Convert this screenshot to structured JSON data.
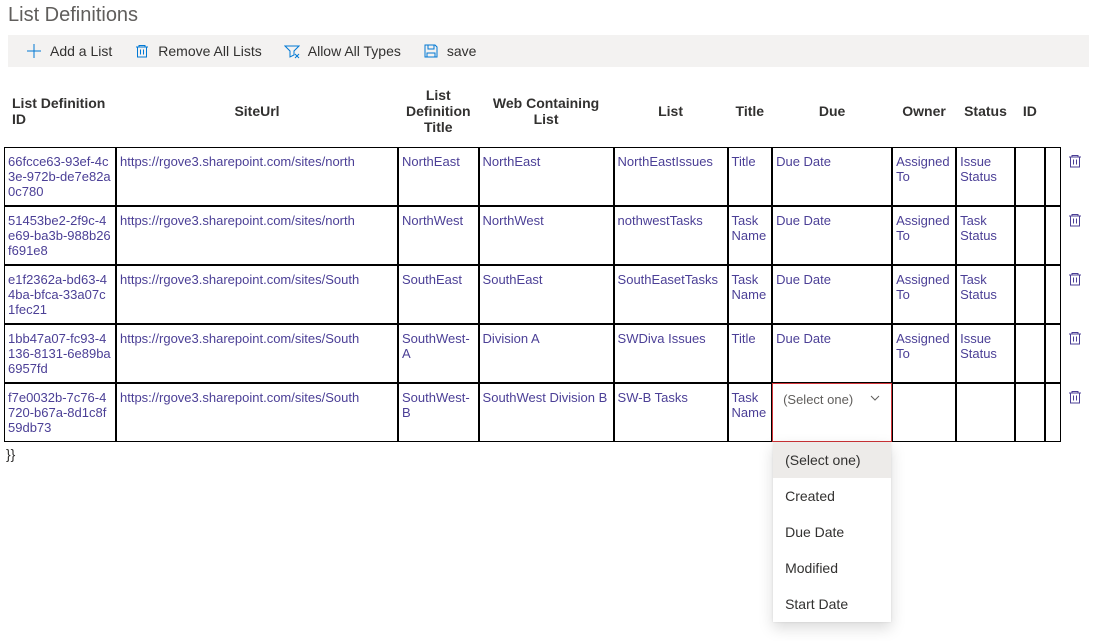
{
  "title": "List Definitions",
  "toolbar": {
    "add": "Add a List",
    "remove_all": "Remove All Lists",
    "allow_all": "Allow All Types",
    "save": "save"
  },
  "columns": {
    "id": "List Definition ID",
    "siteurl": "SiteUrl",
    "deftitle": "List Definition Title",
    "webcontaining": "Web Containing List",
    "list": "List",
    "title": "Title",
    "due": "Due",
    "owner": "Owner",
    "status": "Status",
    "iid": "ID"
  },
  "rows": [
    {
      "id": "66fcce63-93ef-4c3e-972b-de7e82a0c780",
      "siteurl": "https://rgove3.sharepoint.com/sites/north",
      "deftitle": "NorthEast",
      "web": "NorthEast",
      "list": "NorthEastIssues",
      "title": "Title",
      "due": "Due Date",
      "owner": "Assigned To",
      "status": "Issue Status"
    },
    {
      "id": "51453be2-2f9c-4e69-ba3b-988b26f691e8",
      "siteurl": "https://rgove3.sharepoint.com/sites/north",
      "deftitle": "NorthWest",
      "web": "NorthWest",
      "list": "nothwestTasks",
      "title": "Task Name",
      "due": "Due Date",
      "owner": "Assigned To",
      "status": "Task Status"
    },
    {
      "id": "e1f2362a-bd63-44ba-bfca-33a07c1fec21",
      "siteurl": "https://rgove3.sharepoint.com/sites/South",
      "deftitle": "SouthEast",
      "web": "SouthEast",
      "list": "SouthEasetTasks",
      "title": "Task Name",
      "due": "Due Date",
      "owner": "Assigned To",
      "status": "Task Status"
    },
    {
      "id": "1bb47a07-fc93-4136-8131-6e89ba6957fd",
      "siteurl": "https://rgove3.sharepoint.com/sites/South",
      "deftitle": "SouthWest-A",
      "web": "Division A",
      "list": "SWDiva Issues",
      "title": "Title",
      "due": "Due Date",
      "owner": "Assigned To",
      "status": "Issue Status"
    },
    {
      "id": "f7e0032b-7c76-4720-b67a-8d1c8f59db73",
      "siteurl": "https://rgove3.sharepoint.com/sites/South",
      "deftitle": "SouthWest-B",
      "web": "SouthWest Division B",
      "list": "SW-B Tasks",
      "title": "Task Name",
      "due": "",
      "owner": "",
      "status": ""
    }
  ],
  "dropdown": {
    "placeholder": "(Select one)",
    "options": [
      "(Select one)",
      "Created",
      "Due Date",
      "Modified",
      "Start Date"
    ]
  },
  "debug": "}}"
}
